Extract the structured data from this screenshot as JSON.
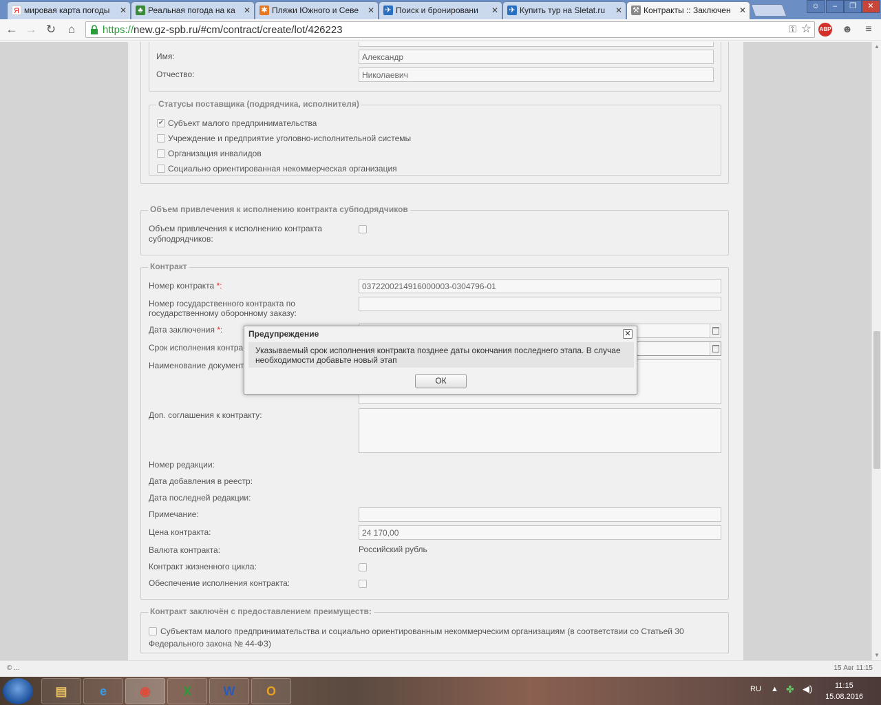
{
  "browser": {
    "tabs": [
      {
        "label": "мировая карта погоды",
        "icon": "yandex-icon",
        "color": "#ee2222"
      },
      {
        "label": "Реальная погода на ка",
        "icon": "palm-icon",
        "color": "#3a8a3a"
      },
      {
        "label": "Пляжи Южного и Севе",
        "icon": "joomla-icon",
        "color": "#e87722"
      },
      {
        "label": "Поиск и бронировани",
        "icon": "sletat-icon",
        "color": "#2a6fc0"
      },
      {
        "label": "Купить тур на Sletat.ru",
        "icon": "sletat-icon",
        "color": "#2a6fc0"
      },
      {
        "label": "Контракты :: Заключен",
        "icon": "gavel-icon",
        "color": "#777777"
      }
    ],
    "url_scheme": "https://",
    "url_rest": "new.gz-spb.ru/#cm/contract/create/lot/426223",
    "abp_label": "ABP"
  },
  "form": {
    "name_label": "Имя:",
    "name_value": "Александр",
    "patronymic_label": "Отчество:",
    "patronymic_value": "Николаевич",
    "statuses": {
      "legend": "Статусы поставщика (подрядчика, исполнителя)",
      "items": [
        {
          "label": "Субъект малого предпринимательства",
          "checked": "✔"
        },
        {
          "label": "Учреждение и предприятие уголовно-исполнительной системы",
          "checked": ""
        },
        {
          "label": "Организация инвалидов",
          "checked": ""
        },
        {
          "label": "Социально ориентированная некоммерческая организация",
          "checked": ""
        }
      ]
    },
    "subcontract": {
      "legend": "Объем привлечения к исполнению контракта субподрядчиков",
      "label_line1": "Объем привлечения к исполнению контракта",
      "label_line2": "субподрядчиков:"
    },
    "contract": {
      "legend": "Контракт",
      "number_label": "Номер контракта",
      "number_value": "0372200214916000003-0304796-01",
      "gov_number_line1": "Номер государственного контракта по",
      "gov_number_line2": "государственному оборонному заказу:",
      "date_label": "Дата заключения",
      "term_label": "Срок исполнения контракта:",
      "docname_label": "Наименование документа:",
      "addenda_label": "Доп. соглашения к контракту:",
      "revision_label": "Номер редакции:",
      "registry_date_label": "Дата добавления в реестр:",
      "last_revision_label": "Дата последней редакции:",
      "note_label": "Примечание:",
      "price_label": "Цена контракта:",
      "price_value": "24 170,00",
      "currency_label": "Валюта контракта:",
      "currency_value": "Российский рубль",
      "lifecycle_label": "Контракт жизненного цикла:",
      "security_label": "Обеспечение исполнения контракта:",
      "required_mark": "*:"
    },
    "advantage": {
      "legend": "Контракт заключён с предоставлением преимуществ:",
      "line1": "Субъектам малого предпринимательства и социально ориентированным некоммерческим организациям (в соответствии со Статьей 30",
      "line2": "Федерального закона № 44-ФЗ)"
    }
  },
  "dialog": {
    "title": "Предупреждение",
    "message_line1": "Указываемый срок исполнения контракта позднее даты окончания последнего этапа. В случае",
    "message_line2": "необходимости добавьте новый этап",
    "ok_label": "ОК",
    "close_glyph": "✕"
  },
  "status": {
    "left": "© ...",
    "right": "15 Авг 11:15"
  },
  "taskbar": {
    "lang": "RU",
    "time": "11:15",
    "date": "15.08.2016",
    "apps": [
      "explorer-icon",
      "ie-icon",
      "chrome-icon",
      "excel-icon",
      "word-icon",
      "outlook-icon"
    ]
  }
}
